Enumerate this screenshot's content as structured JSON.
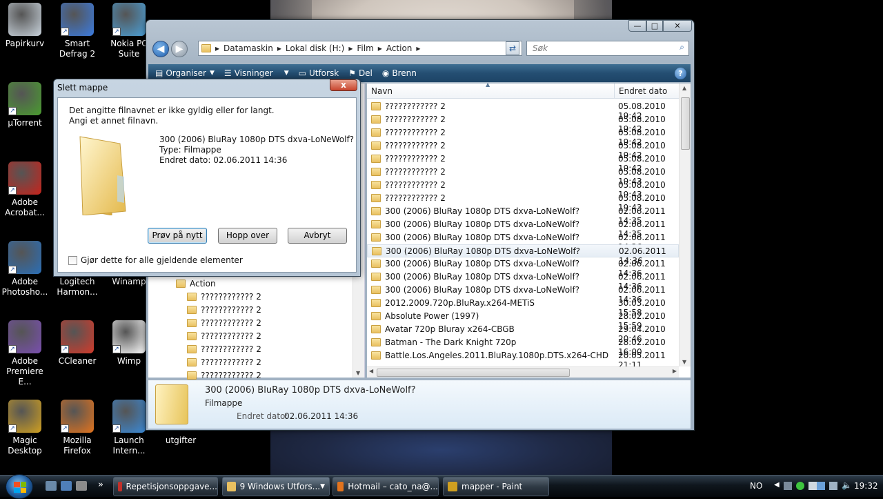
{
  "desktop": {
    "icons": [
      {
        "label": "Papirkurv",
        "color": "#c9d3dc"
      },
      {
        "label": "Smart Defrag 2",
        "color": "#3b7be0"
      },
      {
        "label": "Nokia PC Suite",
        "color": "#4aa0d8"
      },
      {
        "label": "µTorrent",
        "color": "#4a9d2f"
      },
      {
        "label": "Adobe Acrobat...",
        "color": "#c8231b"
      },
      {
        "label": "Adobe Photosho...",
        "color": "#2a6fb8"
      },
      {
        "label": "Logitech Harmon...",
        "color": ""
      },
      {
        "label": "Winamp",
        "color": ""
      },
      {
        "label": "Adobe Premiere E...",
        "color": "#7a4fb0"
      },
      {
        "label": "CCleaner",
        "color": "#d33a2a"
      },
      {
        "label": "Wimp",
        "color": "#ffffff"
      },
      {
        "label": "Magic Desktop",
        "color": "#d0a020"
      },
      {
        "label": "Mozilla Firefox",
        "color": "#e2731d"
      },
      {
        "label": "Launch Intern...",
        "color": "#3a8ad8"
      },
      {
        "label": "utgifter",
        "color": ""
      }
    ]
  },
  "explorer": {
    "buttons": {
      "minimize": "—",
      "maximize": "□",
      "close": "✕"
    },
    "back": "◀",
    "forward": "▶",
    "address": [
      "Datamaskin",
      "Lokal disk (H:)",
      "Film",
      "Action"
    ],
    "search_placeholder": "Søk",
    "toolbar": [
      "Organiser",
      "Visninger",
      "Utforsk",
      "Del",
      "Brenn"
    ],
    "tree": {
      "parent": "Action",
      "items": [
        "???????????? 2",
        "???????????? 2",
        "???????????? 2",
        "???????????? 2",
        "???????????? 2",
        "???????????? 2",
        "???????????? 2"
      ]
    },
    "columns": {
      "name": "Navn",
      "date": "Endret dato"
    },
    "files": [
      {
        "name": "???????????? 2",
        "date": "05.08.2010 19:42"
      },
      {
        "name": "???????????? 2",
        "date": "05.08.2010 19:42"
      },
      {
        "name": "???????????? 2",
        "date": "05.08.2010 19:42"
      },
      {
        "name": "???????????? 2",
        "date": "05.08.2010 19:42"
      },
      {
        "name": "???????????? 2",
        "date": "05.08.2010 19:42"
      },
      {
        "name": "???????????? 2",
        "date": "05.08.2010 19:43"
      },
      {
        "name": "???????????? 2",
        "date": "05.08.2010 19:43"
      },
      {
        "name": "???????????? 2",
        "date": "05.08.2010 19:43"
      },
      {
        "name": "300 (2006) BluRay 1080p DTS dxva-LoNeWolf?",
        "date": "02.06.2011 14:35"
      },
      {
        "name": "300 (2006) BluRay 1080p DTS dxva-LoNeWolf?",
        "date": "02.06.2011 14:35"
      },
      {
        "name": "300 (2006) BluRay 1080p DTS dxva-LoNeWolf?",
        "date": "02.06.2011 14:36"
      },
      {
        "name": "300 (2006) BluRay 1080p DTS dxva-LoNeWolf?",
        "date": "02.06.2011 14:36"
      },
      {
        "name": "300 (2006) BluRay 1080p DTS dxva-LoNeWolf?",
        "date": "02.06.2011 14:36"
      },
      {
        "name": "300 (2006) BluRay 1080p DTS dxva-LoNeWolf?",
        "date": "02.06.2011 14:36"
      },
      {
        "name": "300 (2006) BluRay 1080p DTS dxva-LoNeWolf?",
        "date": "02.06.2011 14:36"
      },
      {
        "name": "2012.2009.720p.BluRay.x264-METiS",
        "date": "30.03.2010 15:58"
      },
      {
        "name": "Absolute Power (1997)",
        "date": "28.02.2010 15:59"
      },
      {
        "name": "Avatar 720p Bluray x264-CBGB",
        "date": "29.04.2010 20:46"
      },
      {
        "name": "Batman - The Dark Knight 720p",
        "date": "28.02.2010 16:00"
      },
      {
        "name": "Battle.Los.Angeles.2011.BluRay.1080p.DTS.x264-CHD",
        "date": "20.05.2011 21:11"
      }
    ],
    "details": {
      "name": "300 (2006) BluRay 1080p DTS dxva-LoNeWolf?",
      "type": "Filmappe",
      "date_label": "Endret dato:",
      "date_value": "02.06.2011 14:36"
    }
  },
  "dialog": {
    "title": "Slett mappe",
    "close": "x",
    "message_line1": "Det angitte filnavnet er ikke gyldig eller for langt.",
    "message_line2": "Angi et annet filnavn.",
    "file_name": "300 (2006) BluRay 1080p DTS dxva-LoNeWolf?",
    "file_type": "Type: Filmappe",
    "file_date": "Endret dato: 02.06.2011 14:36",
    "retry": "Prøv på nytt",
    "skip": "Hopp over",
    "cancel": "Avbryt",
    "checkbox_label": "Gjør dette for alle gjeldende elementer"
  },
  "taskbar": {
    "tasks": [
      {
        "label": "Repetisjonsoppgave...",
        "color": "#c2302a"
      },
      {
        "label": "9 Windows Utfors...",
        "color": "#e9c060"
      },
      {
        "label": "Hotmail – cato_na@...",
        "color": "#e2731d"
      },
      {
        "label": "mapper - Paint",
        "color": "#d0a020"
      }
    ],
    "overflow": "»",
    "language": "NO",
    "clock": "19:32"
  }
}
